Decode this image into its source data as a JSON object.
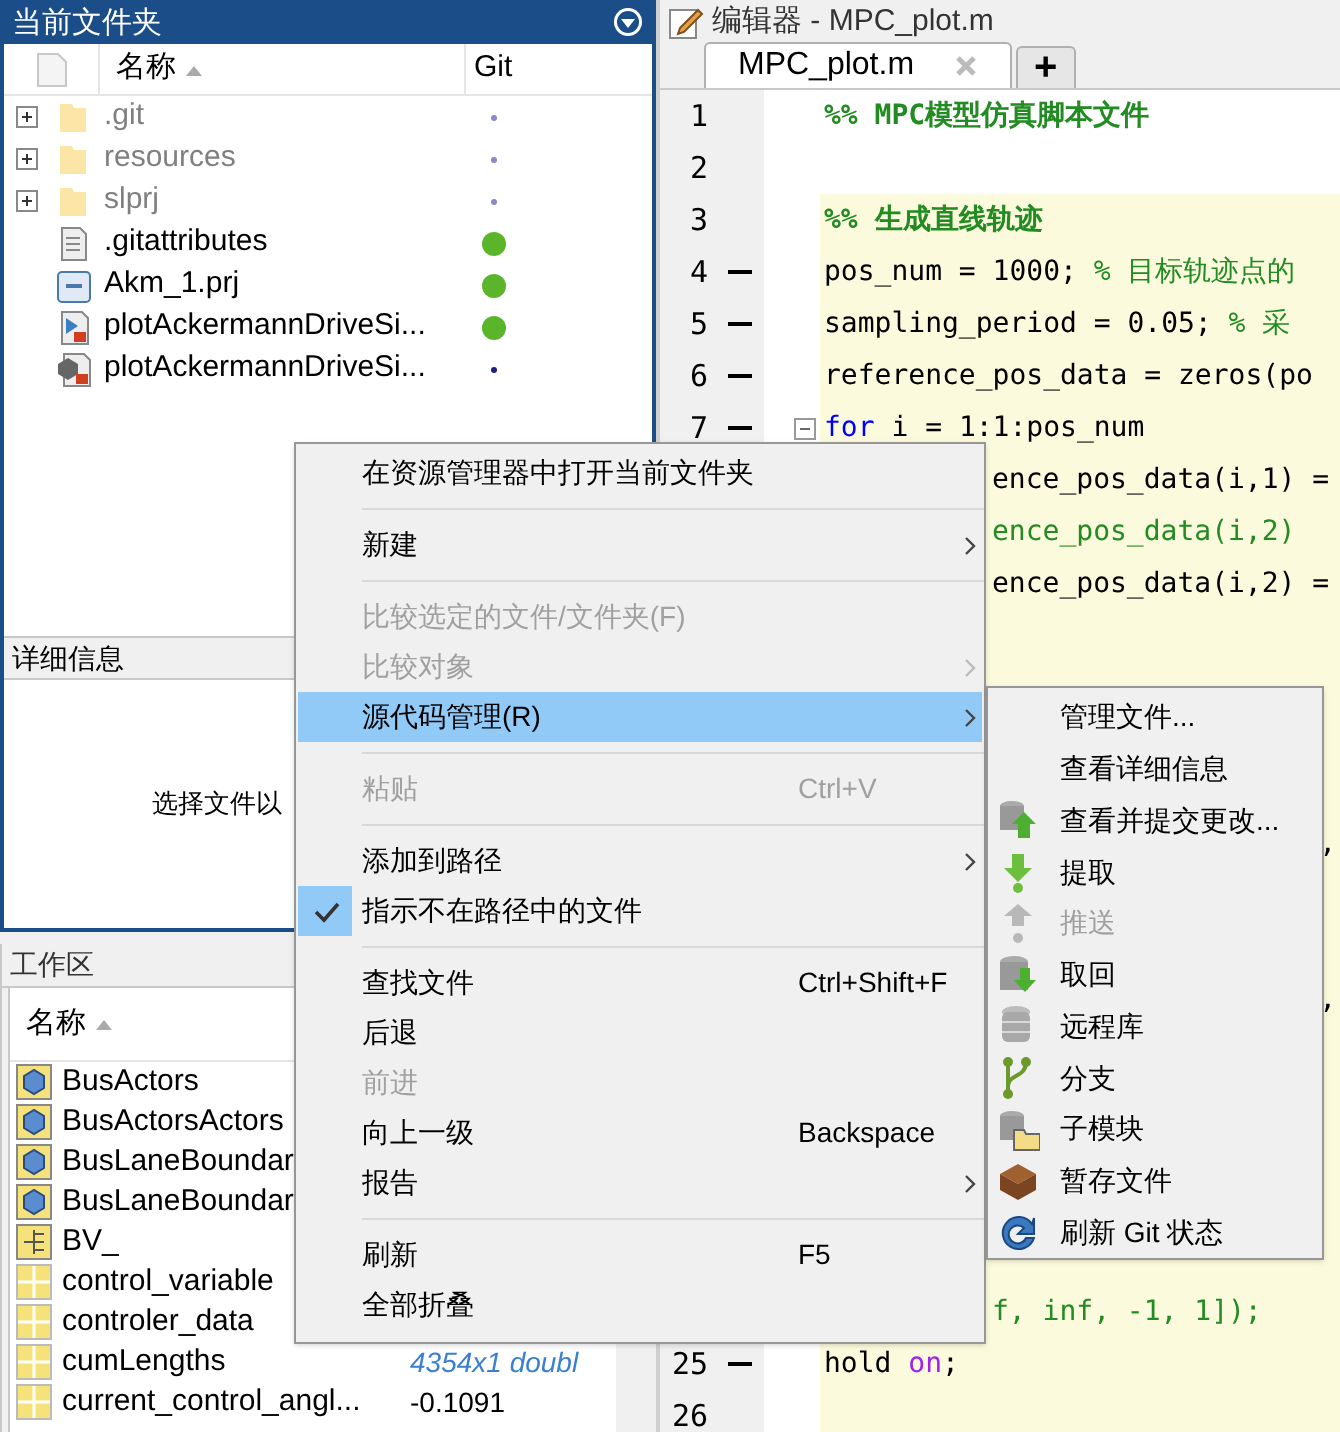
{
  "current_folder": {
    "title": "当前文件夹",
    "columns": [
      "名称",
      "Git"
    ],
    "rows": [
      {
        "name": ".git",
        "kind": "folder",
        "expandable": true,
        "greyed": true,
        "git": {
          "kind": "dot"
        }
      },
      {
        "name": "resources",
        "kind": "folder",
        "expandable": true,
        "greyed": true,
        "git": {
          "kind": "dot"
        }
      },
      {
        "name": "slprj",
        "kind": "folder",
        "expandable": true,
        "greyed": true,
        "git": {
          "kind": "dot"
        }
      },
      {
        "name": ".gitattributes",
        "kind": "text",
        "expandable": false,
        "greyed": false,
        "git": {
          "kind": "circle"
        }
      },
      {
        "name": "Akm_1.prj",
        "kind": "project",
        "expandable": false,
        "greyed": false,
        "git": {
          "kind": "circle"
        }
      },
      {
        "name": "plotAckermannDriveSi...",
        "kind": "script",
        "expandable": false,
        "greyed": false,
        "git": {
          "kind": "circle"
        }
      },
      {
        "name": "plotAckermannDriveSi...",
        "kind": "model",
        "expandable": false,
        "greyed": false,
        "git": {
          "kind": "dark_dot"
        }
      }
    ]
  },
  "details": {
    "title": "详细信息",
    "message": "选择文件以"
  },
  "workspace": {
    "title": "工作区",
    "columns": [
      "名称"
    ],
    "rows": [
      {
        "name": "BusActors",
        "kind": "bus"
      },
      {
        "name": "BusActorsActors",
        "kind": "bus"
      },
      {
        "name": "BusLaneBoundar",
        "kind": "bus"
      },
      {
        "name": "BusLaneBoundar",
        "kind": "bus"
      },
      {
        "name": "BV_",
        "kind": "struct"
      },
      {
        "name": "control_variable",
        "kind": "matrix"
      },
      {
        "name": "controler_data",
        "kind": "matrix"
      },
      {
        "name": "cumLengths",
        "kind": "matrix",
        "value": {
          "kind": "summary",
          "text": "4354x1 doubl"
        }
      },
      {
        "name": "current_control_angl...",
        "kind": "matrix",
        "value": {
          "kind": "scalar",
          "text": "-0.1091"
        }
      }
    ]
  },
  "editor": {
    "title": "编辑器 - MPC_plot.m",
    "tabs": [
      {
        "label": "MPC_plot.m",
        "selected": true,
        "closable": true
      },
      {
        "label": "+",
        "selected": false,
        "closable": false
      }
    ],
    "lines": [
      {
        "kind": "full",
        "number": "1",
        "executable": false,
        "highlighted": false,
        "fold": false,
        "segments": [
          {
            "kind": "section",
            "text": "%% MPC模型仿真脚本文件"
          }
        ]
      },
      {
        "kind": "full",
        "number": "2",
        "executable": false,
        "highlighted": false,
        "fold": false
      },
      {
        "kind": "full",
        "number": "3",
        "executable": false,
        "highlighted": true,
        "fold": false,
        "segments": [
          {
            "kind": "section",
            "text": "%% 生成直线轨迹"
          }
        ]
      },
      {
        "kind": "full",
        "number": "4",
        "executable": true,
        "highlighted": true,
        "fold": false,
        "segments": [
          {
            "kind": "code",
            "text": "pos_num = 1000; "
          },
          {
            "kind": "comment",
            "text": "% 目标轨迹点的"
          }
        ]
      },
      {
        "kind": "full",
        "number": "5",
        "executable": true,
        "highlighted": true,
        "fold": false,
        "segments": [
          {
            "kind": "code",
            "text": "sampling_period = 0.05; "
          },
          {
            "kind": "comment",
            "text": "% 采"
          }
        ]
      },
      {
        "kind": "full",
        "number": "6",
        "executable": true,
        "highlighted": true,
        "fold": false,
        "segments": [
          {
            "kind": "code",
            "text": "reference_pos_data = zeros(po"
          }
        ]
      },
      {
        "kind": "full",
        "number": "7",
        "executable": true,
        "highlighted": true,
        "fold": true,
        "segments": [
          {
            "kind": "keyword",
            "text": "for"
          },
          {
            "kind": "code",
            "text": " i = 1:1:pos_num"
          }
        ]
      },
      {
        "kind": "tail",
        "highlighted": true,
        "segments": [
          {
            "kind": "code",
            "text": "ence_pos_data(i,1) ="
          }
        ]
      },
      {
        "kind": "tail",
        "highlighted": true,
        "segments": [
          {
            "kind": "comment",
            "text": "ence_pos_data(i,2)"
          }
        ]
      },
      {
        "kind": "tail",
        "highlighted": true,
        "segments": [
          {
            "kind": "code",
            "text": "ence_pos_data(i,2) ="
          }
        ]
      },
      {
        "kind": "tail",
        "highlighted": true
      },
      {
        "kind": "tail",
        "highlighted": true
      },
      {
        "kind": "tail",
        "highlighted": true
      },
      {
        "kind": "tail",
        "highlighted": true
      },
      {
        "kind": "edge",
        "highlighted": true,
        "segments": [
          {
            "kind": "code",
            "text": ","
          }
        ]
      },
      {
        "kind": "tail",
        "highlighted": true
      },
      {
        "kind": "tail",
        "highlighted": true
      },
      {
        "kind": "edge",
        "highlighted": true,
        "segments": [
          {
            "kind": "code",
            "text": ","
          }
        ]
      },
      {
        "kind": "tail",
        "highlighted": true
      },
      {
        "kind": "tail",
        "highlighted": true
      },
      {
        "kind": "tail",
        "highlighted": true
      },
      {
        "kind": "tail",
        "highlighted": true
      },
      {
        "kind": "tail",
        "highlighted": true
      },
      {
        "kind": "tail",
        "highlighted": true,
        "segments": [
          {
            "kind": "comment",
            "text": "f, inf, -1, 1]);"
          }
        ]
      },
      {
        "kind": "full",
        "number": "25",
        "executable": true,
        "highlighted": true,
        "fold": false,
        "segments": [
          {
            "kind": "code",
            "text": "hold "
          },
          {
            "kind": "arg",
            "text": "on"
          },
          {
            "kind": "code",
            "text": ";"
          }
        ]
      },
      {
        "kind": "full",
        "number": "26",
        "executable": false,
        "highlighted": true,
        "fold": false
      }
    ]
  },
  "context_menu": {
    "items": [
      {
        "kind": "item",
        "label": "在资源管理器中打开当前文件夹",
        "submenu": false,
        "disabled": false,
        "selected": false,
        "checked": false
      },
      {
        "kind": "separator"
      },
      {
        "kind": "item",
        "label": "新建",
        "submenu": true,
        "disabled": false,
        "selected": false,
        "checked": false
      },
      {
        "kind": "separator"
      },
      {
        "kind": "item",
        "label": "比较选定的文件/文件夹(F)",
        "submenu": false,
        "disabled": true,
        "selected": false,
        "checked": false
      },
      {
        "kind": "item",
        "label": "比较对象",
        "submenu": true,
        "disabled": true,
        "selected": false,
        "checked": false
      },
      {
        "kind": "item",
        "label": "源代码管理(R)",
        "submenu": true,
        "disabled": false,
        "selected": true,
        "checked": false
      },
      {
        "kind": "separator"
      },
      {
        "kind": "item",
        "label": "粘贴",
        "shortcut": "Ctrl+V",
        "submenu": false,
        "disabled": true,
        "selected": false,
        "checked": false
      },
      {
        "kind": "separator"
      },
      {
        "kind": "item",
        "label": "添加到路径",
        "submenu": true,
        "disabled": false,
        "selected": false,
        "checked": false
      },
      {
        "kind": "item",
        "label": "指示不在路径中的文件",
        "submenu": false,
        "disabled": false,
        "selected": false,
        "checked": true
      },
      {
        "kind": "separator"
      },
      {
        "kind": "item",
        "label": "查找文件",
        "shortcut": "Ctrl+Shift+F",
        "submenu": false,
        "disabled": false,
        "selected": false,
        "checked": false
      },
      {
        "kind": "item",
        "label": "后退",
        "submenu": false,
        "disabled": false,
        "selected": false,
        "checked": false
      },
      {
        "kind": "item",
        "label": "前进",
        "submenu": false,
        "disabled": true,
        "selected": false,
        "checked": false
      },
      {
        "kind": "item",
        "label": "向上一级",
        "shortcut": "Backspace",
        "submenu": false,
        "disabled": false,
        "selected": false,
        "checked": false
      },
      {
        "kind": "item",
        "label": "报告",
        "submenu": true,
        "disabled": false,
        "selected": false,
        "checked": false
      },
      {
        "kind": "separator"
      },
      {
        "kind": "item",
        "label": "刷新",
        "shortcut": "F5",
        "submenu": false,
        "disabled": false,
        "selected": false,
        "checked": false
      },
      {
        "kind": "item",
        "label": "全部折叠",
        "submenu": false,
        "disabled": false,
        "selected": false,
        "checked": false
      }
    ]
  },
  "source_control_menu": {
    "items": [
      {
        "label": "管理文件...",
        "kind": "plain",
        "disabled": false
      },
      {
        "label": "查看详细信息",
        "kind": "plain",
        "disabled": false
      },
      {
        "label": "查看并提交更改...",
        "kind": "commit",
        "disabled": false
      },
      {
        "label": "提取",
        "kind": "fetch",
        "disabled": false
      },
      {
        "label": "推送",
        "kind": "push",
        "disabled": true
      },
      {
        "label": "取回",
        "kind": "pull",
        "disabled": false
      },
      {
        "label": "远程库",
        "kind": "remote",
        "disabled": false
      },
      {
        "label": "分支",
        "kind": "branch",
        "disabled": false
      },
      {
        "label": "子模块",
        "kind": "submodule",
        "disabled": false
      },
      {
        "label": "暂存文件",
        "kind": "stash",
        "disabled": false
      },
      {
        "label": "刷新 Git 状态",
        "kind": "refresh",
        "disabled": false
      }
    ]
  }
}
